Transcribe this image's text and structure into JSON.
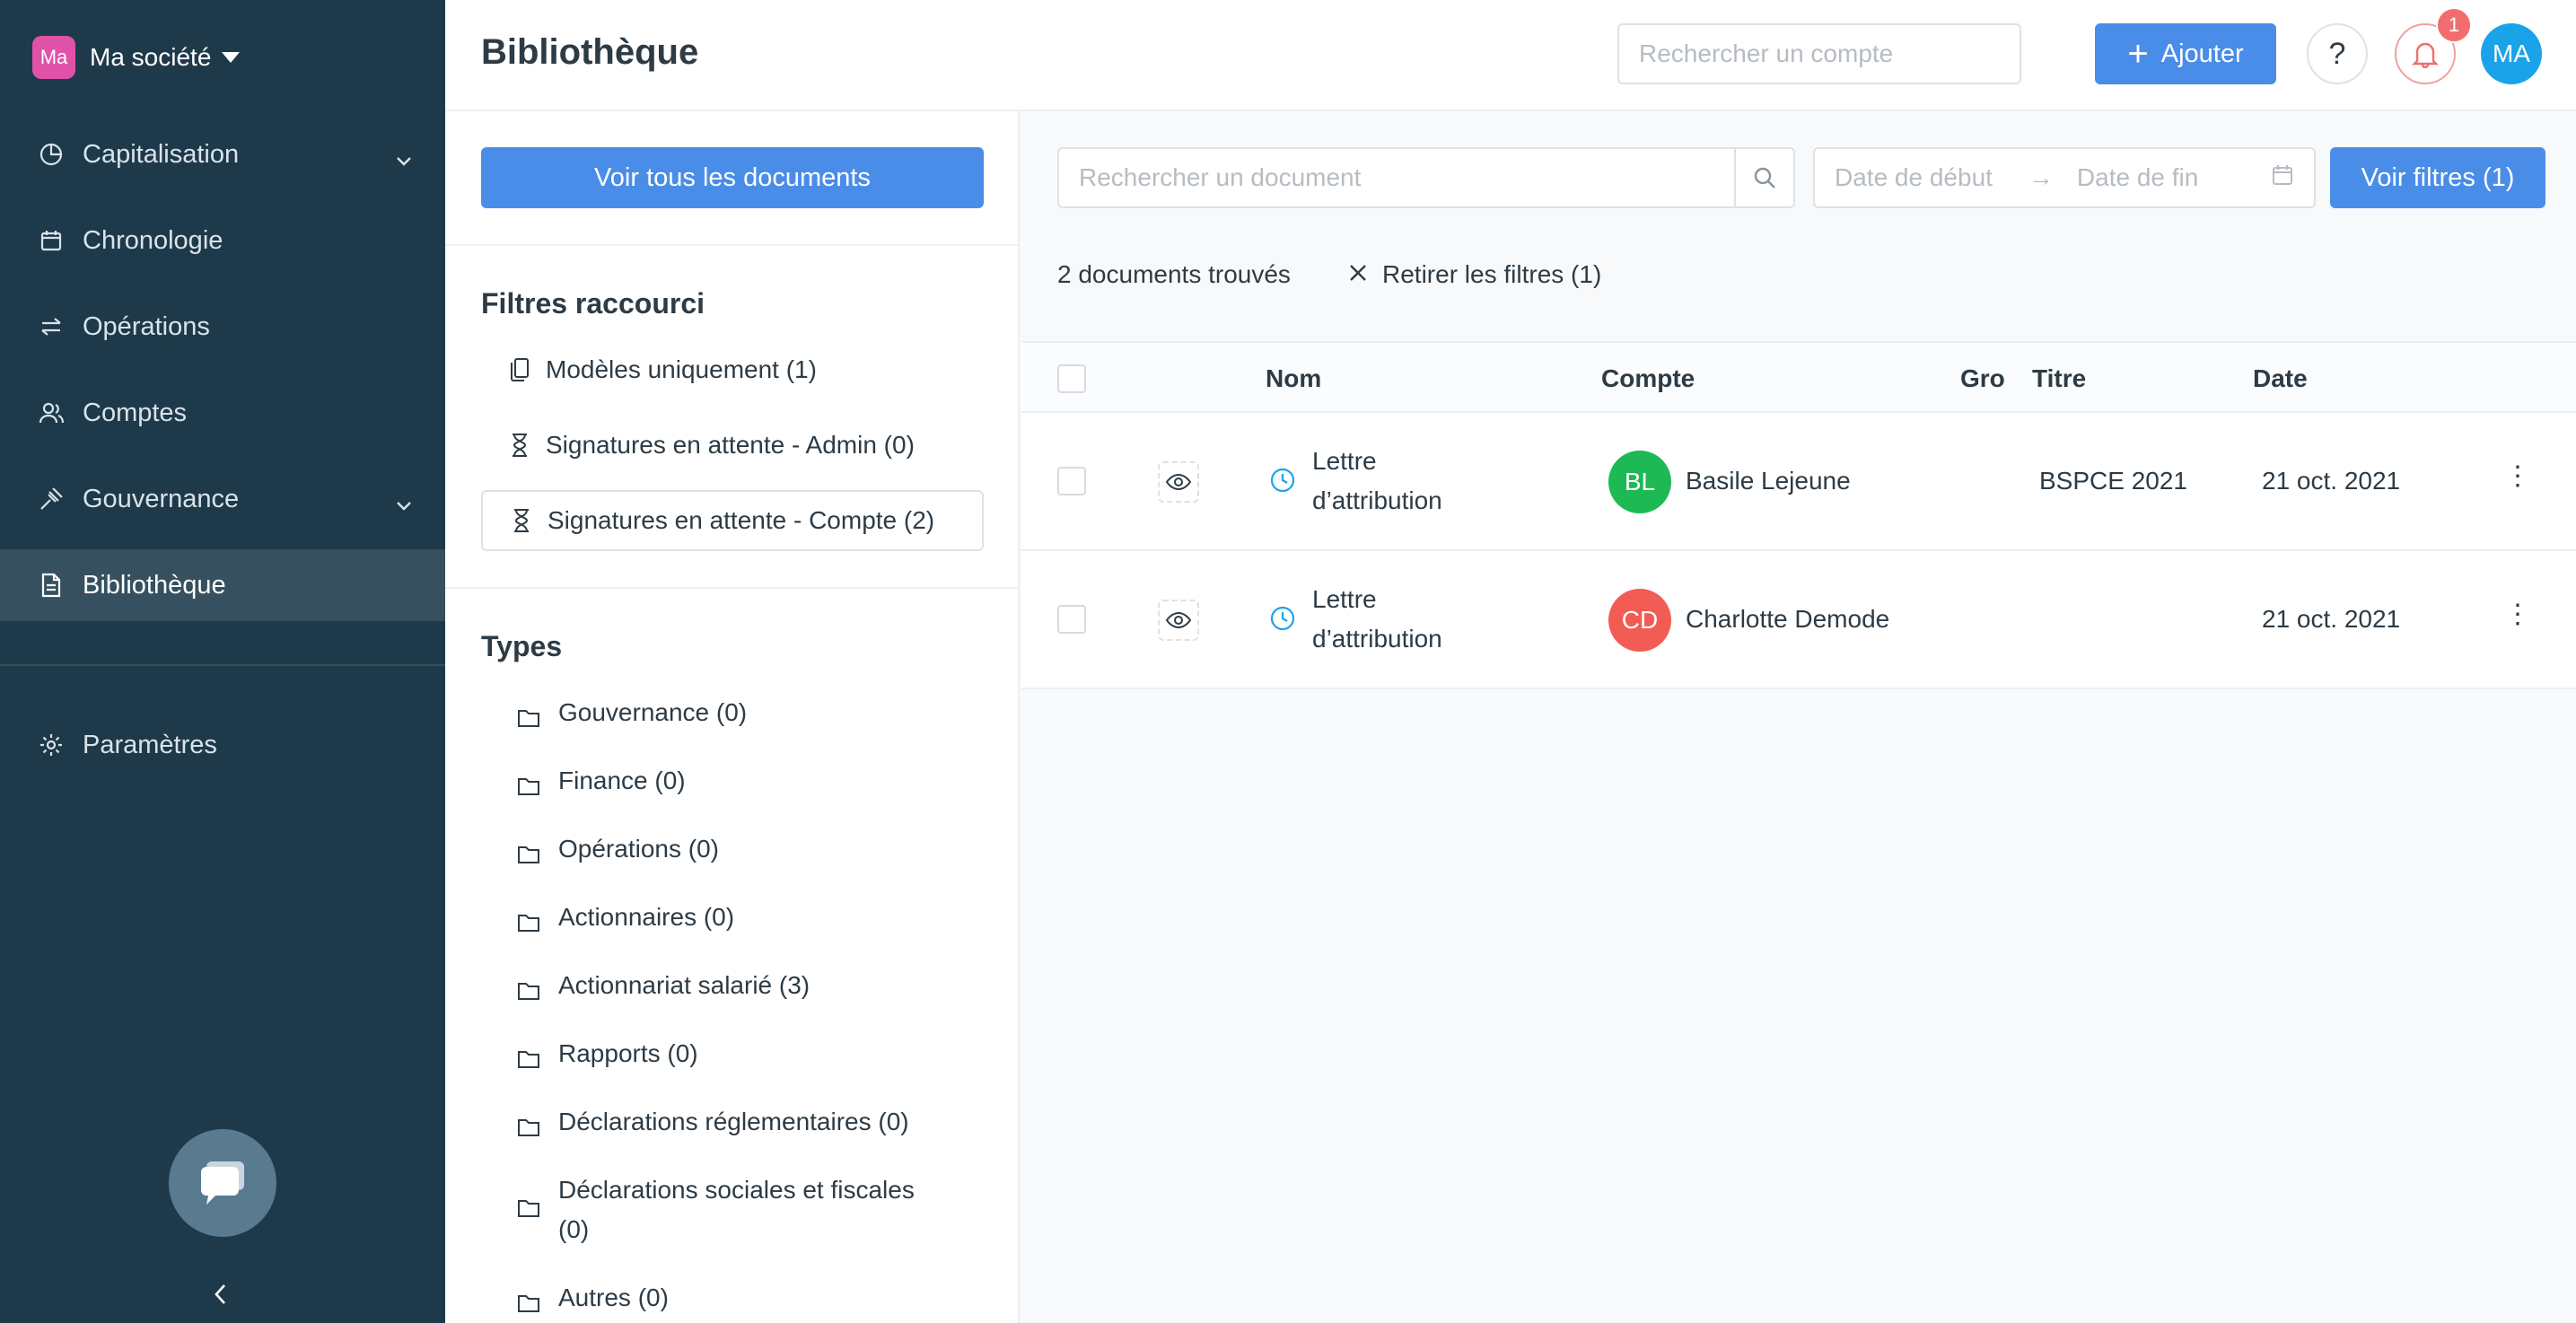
{
  "company": {
    "logo": "Ma",
    "name": "Ma société"
  },
  "sidebar": {
    "items": [
      {
        "label": "Capitalisation",
        "icon": "pie-chart-icon",
        "chevron": true
      },
      {
        "label": "Chronologie",
        "icon": "calendar-icon"
      },
      {
        "label": "Opérations",
        "icon": "swap-icon"
      },
      {
        "label": "Comptes",
        "icon": "users-icon"
      },
      {
        "label": "Gouvernance",
        "icon": "gavel-icon",
        "chevron": true
      },
      {
        "label": "Bibliothèque",
        "icon": "document-icon",
        "active": true
      }
    ],
    "settings": {
      "label": "Paramètres",
      "icon": "gear-icon"
    }
  },
  "header": {
    "title": "Bibliothèque",
    "account_search_placeholder": "Rechercher un compte",
    "add_label": "Ajouter",
    "help": "?",
    "notification_count": "1",
    "user_initials": "MA"
  },
  "filters": {
    "all_docs_label": "Voir tous les documents",
    "shortcuts_title": "Filtres raccourci",
    "shortcuts": [
      {
        "label": "Modèles uniquement (1)",
        "icon": "copy-icon"
      },
      {
        "label": "Signatures en attente - Admin (0)",
        "icon": "hourglass-icon"
      },
      {
        "label": "Signatures en attente - Compte (2)",
        "icon": "hourglass-icon",
        "selected": true
      }
    ],
    "types_title": "Types",
    "types": [
      "Gouvernance (0)",
      "Finance (0)",
      "Opérations (0)",
      "Actionnaires (0)",
      "Actionnariat salarié (3)",
      "Rapports (0)",
      "Déclarations réglementaires (0)",
      "Déclarations sociales et fiscales (0)",
      "Autres (0)"
    ]
  },
  "main": {
    "doc_search_placeholder": "Rechercher un document",
    "date_start_placeholder": "Date de début",
    "date_end_placeholder": "Date de fin",
    "filters_button": "Voir filtres (1)",
    "result_count": "2 documents trouvés",
    "clear_filters": "Retirer les filtres (1)",
    "columns": [
      "Nom",
      "Compte",
      "Gro",
      "Titre",
      "Date"
    ],
    "rows": [
      {
        "name": "Lettre d’attribution",
        "initials": "BL",
        "avatar_color": "#1db954",
        "account": "Basile Lejeune",
        "title": "BSPCE 2021",
        "date": "21 oct. 2021"
      },
      {
        "name": "Lettre d’attribution",
        "initials": "CD",
        "avatar_color": "#f25c54",
        "account": "Charlotte Demode",
        "title": "",
        "date": "21 oct. 2021"
      }
    ]
  },
  "colors": {
    "sidebar": "#1e3a4a",
    "primary": "#4a8de8",
    "active_nav": "#36505f"
  }
}
